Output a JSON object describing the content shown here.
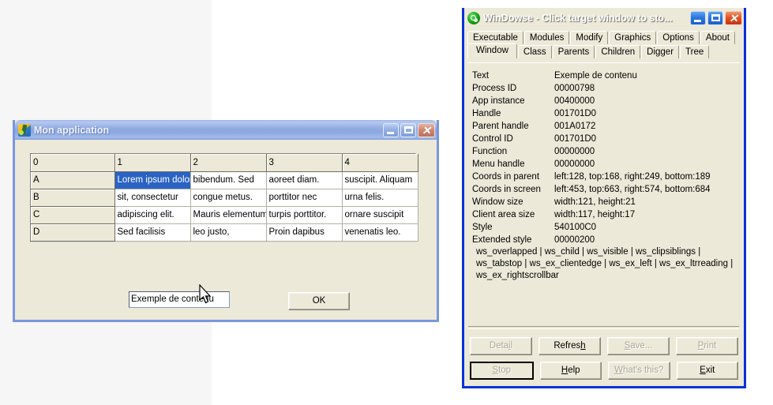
{
  "windowse": {
    "title": "WinDowse - Click target window to sto...",
    "icon": "key-circle-icon",
    "window_buttons": {
      "minimize": "minimize-icon",
      "maximize": "maximize-icon",
      "close": "close-icon"
    },
    "tabs_row1": [
      {
        "label": "Executable",
        "selected": false
      },
      {
        "label": "Modules",
        "selected": false
      },
      {
        "label": "Modify",
        "selected": false
      },
      {
        "label": "Graphics",
        "selected": false
      },
      {
        "label": "Options",
        "selected": false
      },
      {
        "label": "About",
        "selected": false
      }
    ],
    "tabs_row2": [
      {
        "label": "Window",
        "selected": true
      },
      {
        "label": "Class",
        "selected": false
      },
      {
        "label": "Parents",
        "selected": false
      },
      {
        "label": "Children",
        "selected": false
      },
      {
        "label": "Digger",
        "selected": false
      },
      {
        "label": "Tree",
        "selected": false
      }
    ],
    "properties": [
      {
        "label": "Text",
        "value": "Exemple de contenu"
      },
      {
        "label": "Process ID",
        "value": "00000798"
      },
      {
        "label": "App instance",
        "value": "00400000"
      },
      {
        "label": "Handle",
        "value": "001701D0"
      },
      {
        "label": "Parent handle",
        "value": "001A0172"
      },
      {
        "label": "Control ID",
        "value": "001701D0"
      },
      {
        "label": "Function",
        "value": "00000000"
      },
      {
        "label": "Menu handle",
        "value": "00000000"
      },
      {
        "label": "Coords in parent",
        "value": "left:128, top:168, right:249, bottom:189"
      },
      {
        "label": "Coords in screen",
        "value": "left:453, top:663, right:574, bottom:684"
      },
      {
        "label": "Window size",
        "value": "width:121, height:21"
      },
      {
        "label": "Client area size",
        "value": "width:117, height:17"
      },
      {
        "label": "Style",
        "value": "540100C0"
      },
      {
        "label": "Extended style",
        "value": "00000200"
      }
    ],
    "style_flags_lines": [
      "ws_overlapped | ws_child | ws_visible | ws_clipsiblings |",
      "ws_tabstop | ws_ex_clientedge | ws_ex_left | ws_ex_ltrreading |",
      "ws_ex_rightscrollbar"
    ],
    "buttons_row1": [
      {
        "label": "Detail",
        "mnemonic": "i",
        "disabled": true,
        "focused": false
      },
      {
        "label": "Refresh",
        "mnemonic": "h",
        "disabled": false,
        "focused": false
      },
      {
        "label": "Save...",
        "mnemonic": "S",
        "disabled": true,
        "focused": false
      },
      {
        "label": "Print",
        "mnemonic": "P",
        "disabled": true,
        "focused": false
      }
    ],
    "buttons_row2": [
      {
        "label": "Stop",
        "mnemonic": "S",
        "disabled": true,
        "focused": true
      },
      {
        "label": "Help",
        "mnemonic": "H",
        "disabled": false,
        "focused": false
      },
      {
        "label": "What's this?",
        "mnemonic": "W",
        "disabled": true,
        "focused": false
      },
      {
        "label": "Exit",
        "mnemonic": "E",
        "disabled": false,
        "focused": false
      }
    ]
  },
  "monapp": {
    "title": "Mon application",
    "icon": "app-icon",
    "window_buttons": {
      "minimize": "minimize-icon",
      "maximize": "maximize-icon",
      "close": "close-icon"
    },
    "grid": {
      "headers": [
        "0",
        "1",
        "2",
        "3",
        "4"
      ],
      "rows": [
        {
          "header": "A",
          "cells": [
            "Lorem ipsum dolor",
            "bibendum. Sed",
            "aoreet diam.",
            "suscipit. Aliquam"
          ],
          "selected_cell": 0
        },
        {
          "header": "B",
          "cells": [
            "sit, consectetur",
            "congue metus.",
            "porttitor nec",
            "urna felis."
          ],
          "selected_cell": -1
        },
        {
          "header": "C",
          "cells": [
            "adipiscing elit.",
            "Mauris elementum",
            "turpis porttitor.",
            "ornare suscipit"
          ],
          "selected_cell": -1
        },
        {
          "header": "D",
          "cells": [
            "Sed facilisis",
            "leo justo,",
            "Proin dapibus",
            "venenatis leo."
          ],
          "selected_cell": -1
        }
      ]
    },
    "textfield_value": "Exemple de contenu",
    "ok_button": "OK"
  },
  "cursor": {
    "name": "mouse-arrow-pointer"
  },
  "colors": {
    "active_title": "#0a52cd",
    "inactive_title": "#8da7e1",
    "window_face": "#ece9d8",
    "selection_blue": "#2a63c4",
    "close_red": "#c3330f"
  }
}
